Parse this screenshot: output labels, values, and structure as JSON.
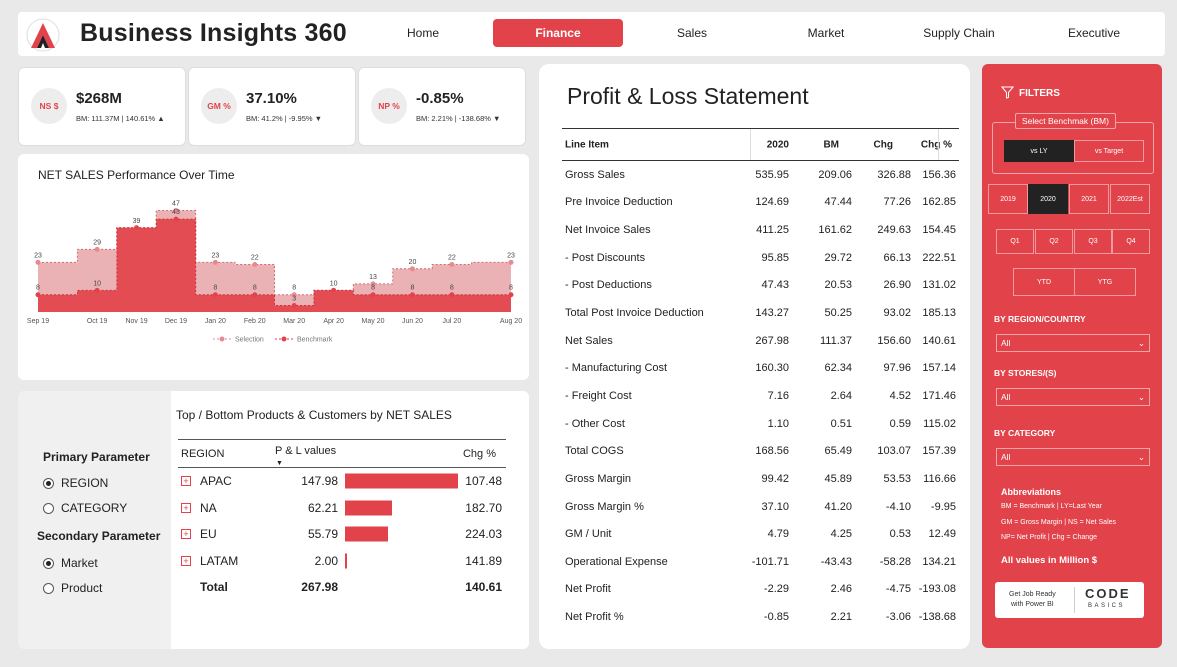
{
  "header": {
    "brand": "Business Insights 360",
    "nav": [
      {
        "label": "Home"
      },
      {
        "label": "Finance"
      },
      {
        "label": "Sales"
      },
      {
        "label": "Market"
      },
      {
        "label": "Supply Chain"
      },
      {
        "label": "Executive"
      }
    ],
    "active_tab": "Finance"
  },
  "kpis": [
    {
      "badge": "NS $",
      "value": "$268M",
      "sub": "BM: 111.37M | 140.61% ▲"
    },
    {
      "badge": "GM %",
      "value": "37.10%",
      "sub": "BM: 41.2% | -9.95% ▼"
    },
    {
      "badge": "NP %",
      "value": "-0.85%",
      "sub": "BM: 2.21% | -138.68% ▼"
    }
  ],
  "net_sales_chart": {
    "title": "NET SALES Performance Over Time",
    "legend": {
      "selection": "Selection",
      "benchmark": "Benchmark"
    }
  },
  "chart_data": {
    "type": "area",
    "title": "NET SALES Performance Over Time",
    "categories": [
      "Sep 19",
      "Oct 19",
      "Nov 19",
      "Dec 19",
      "Jan 20",
      "Feb 20",
      "Mar 20",
      "Apr 20",
      "May 20",
      "Jun 20",
      "Jul 20",
      "Aug 20"
    ],
    "series": [
      {
        "name": "Selection",
        "values": [
          8,
          10,
          39,
          43,
          8,
          8,
          3,
          10,
          8,
          8,
          8,
          8
        ]
      },
      {
        "name": "Benchmark",
        "values": [
          23,
          29,
          39,
          47,
          23,
          22,
          8,
          10,
          13,
          20,
          22,
          23
        ]
      }
    ],
    "colors": {
      "selection": "#e2434b",
      "benchmark": "#e8a4a8"
    },
    "grid": false,
    "legend_position": "bottom"
  },
  "params": {
    "primary_label": "Primary Parameter",
    "primary_options": [
      "REGION",
      "CATEGORY"
    ],
    "primary_selected": 0,
    "secondary_label": "Secondary Parameter",
    "secondary_options": [
      "Market",
      "Product"
    ],
    "secondary_selected": 0
  },
  "products": {
    "title": "Top / Bottom Products & Customers by NET SALES",
    "headers": {
      "region": "REGION",
      "pl": "P & L values",
      "chg": "Chg %"
    },
    "rows": [
      {
        "name": "APAC",
        "value": "147.98",
        "fraction": 1.0,
        "chg": "107.48"
      },
      {
        "name": "NA",
        "value": "62.21",
        "fraction": 0.42,
        "chg": "182.70"
      },
      {
        "name": "EU",
        "value": "55.79",
        "fraction": 0.377,
        "chg": "224.03"
      },
      {
        "name": "LATAM",
        "value": "2.00",
        "fraction": 0.0135,
        "chg": "141.89"
      }
    ],
    "total": {
      "label": "Total",
      "value": "267.98",
      "chg": "140.61"
    }
  },
  "pl": {
    "title": "Profit & Loss Statement",
    "headers": {
      "item": "Line Item",
      "y": "2020",
      "bm": "BM",
      "chg": "Chg",
      "chgp": "Chg %"
    },
    "rows": [
      {
        "item": "Gross Sales",
        "y": "535.95",
        "bm": "209.06",
        "chg": "326.88",
        "chgp": "156.36"
      },
      {
        "item": "Pre Invoice Deduction",
        "y": "124.69",
        "bm": "47.44",
        "chg": "77.26",
        "chgp": "162.85"
      },
      {
        "item": "Net Invoice Sales",
        "y": "411.25",
        "bm": "161.62",
        "chg": "249.63",
        "chgp": "154.45"
      },
      {
        "item": " - Post Discounts",
        "y": "95.85",
        "bm": "29.72",
        "chg": "66.13",
        "chgp": "222.51"
      },
      {
        "item": " - Post Deductions",
        "y": "47.43",
        "bm": "20.53",
        "chg": "26.90",
        "chgp": "131.02"
      },
      {
        "item": "Total Post Invoice Deduction",
        "y": "143.27",
        "bm": "50.25",
        "chg": "93.02",
        "chgp": "185.13"
      },
      {
        "item": "Net Sales",
        "y": "267.98",
        "bm": "111.37",
        "chg": "156.60",
        "chgp": "140.61"
      },
      {
        "item": " - Manufacturing Cost",
        "y": "160.30",
        "bm": "62.34",
        "chg": "97.96",
        "chgp": "157.14"
      },
      {
        "item": " - Freight Cost",
        "y": "7.16",
        "bm": "2.64",
        "chg": "4.52",
        "chgp": "171.46"
      },
      {
        "item": " - Other Cost",
        "y": "1.10",
        "bm": "0.51",
        "chg": "0.59",
        "chgp": "115.02"
      },
      {
        "item": "Total COGS",
        "y": "168.56",
        "bm": "65.49",
        "chg": "103.07",
        "chgp": "157.39"
      },
      {
        "item": "Gross Margin",
        "y": "99.42",
        "bm": "45.89",
        "chg": "53.53",
        "chgp": "116.66"
      },
      {
        "item": "Gross Margin %",
        "y": "37.10",
        "bm": "41.20",
        "chg": "-4.10",
        "chgp": "-9.95"
      },
      {
        "item": "GM / Unit",
        "y": "4.79",
        "bm": "4.25",
        "chg": "0.53",
        "chgp": "12.49"
      },
      {
        "item": "Operational Expense",
        "y": "-101.71",
        "bm": "-43.43",
        "chg": "-58.28",
        "chgp": "134.21"
      },
      {
        "item": "Net Profit",
        "y": "-2.29",
        "bm": "2.46",
        "chg": "-4.75",
        "chgp": "-193.08"
      },
      {
        "item": "Net Profit %",
        "y": "-0.85",
        "bm": "2.21",
        "chg": "-3.06",
        "chgp": "-138.68"
      }
    ]
  },
  "filters": {
    "title": "FILTERS",
    "benchmark_label": "Select Benchmak (BM)",
    "benchmark_options": [
      "vs LY",
      "vs Target"
    ],
    "benchmark_selected": 0,
    "years": [
      "2019",
      "2020",
      "2021",
      "2022Est"
    ],
    "year_selected": "2020",
    "quarters": [
      "Q1",
      "Q2",
      "Q3",
      "Q4"
    ],
    "periods": [
      "YTD",
      "YTG"
    ],
    "region_label": "BY REGION/COUNTRY",
    "region_value": "All",
    "stores_label": "BY STORES/(S)",
    "stores_value": "All",
    "category_label": "BY CATEGORY",
    "category_value": "All",
    "abbr_title": "Abbreviations",
    "abbr_lines": [
      "BM = Benchmark | LY=Last Year",
      "GM = Gross Margin | NS = Net Sales",
      "NP= Net Profit | Chg = Change"
    ],
    "values_note": "All values in Million $",
    "promo_line1": "Get Job Ready",
    "promo_line2": "with Power BI",
    "promo_brand": "CODE",
    "promo_brand_sub": "BASICS"
  }
}
